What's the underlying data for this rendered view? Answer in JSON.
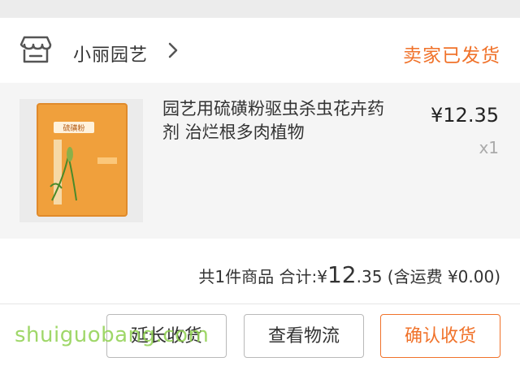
{
  "shop": {
    "name": "小丽园艺",
    "status": "卖家已发货"
  },
  "item": {
    "title": "园艺用硫磺粉驱虫杀虫花卉药剂 治烂根多肉植物",
    "price": "¥12.35",
    "qty": "x1",
    "thumbnail_label": "硫磺粉"
  },
  "summary": {
    "count_text": "共1件商品",
    "total_label": "合计:",
    "currency": "¥",
    "total_int": "12",
    "total_dec": ".35",
    "shipping_text": "(含运费 ¥0.00)"
  },
  "actions": {
    "extend_label": "延长收货",
    "logistics_label": "查看物流",
    "confirm_label": "确认收货"
  },
  "watermark": "shuiguobang.com",
  "colors": {
    "accent": "#f0722a",
    "watermark": "#8fd14f"
  }
}
